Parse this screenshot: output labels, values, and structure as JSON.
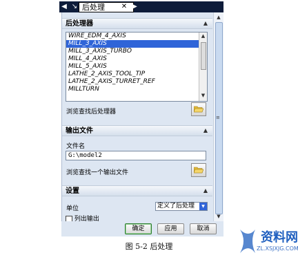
{
  "tab": {
    "left_arrow": "◀",
    "pin": "↘",
    "title": "后处理",
    "close": "✕",
    "right_arrow": "▶"
  },
  "postprocessors_section": {
    "header": "后处理器",
    "items": [
      "WIRE_EDM_4_AXIS",
      "MILL_3_AXIS",
      "MILL_3_AXIS_TURBO",
      "MILL_4_AXIS",
      "MILL_5_AXIS",
      "LATHE_2_AXIS_TOOL_TIP",
      "LATHE_2_AXIS_TURRET_REF",
      "MILLTURN"
    ],
    "selected_index": 1,
    "browse_label": "浏览查找后处理器"
  },
  "output_section": {
    "header": "输出文件",
    "file_name_label": "文件名",
    "file_name_value": "G:\\model2",
    "browse_label": "浏览查找一个输出文件"
  },
  "settings_section": {
    "header": "设置",
    "unit_label": "单位",
    "unit_value": "定义了后处理",
    "checkbox_label": "列出输出"
  },
  "buttons": {
    "ok": "确定",
    "apply": "应用",
    "cancel": "取消"
  },
  "caption": "图 5-2  后处理",
  "watermark": {
    "text": "资料网",
    "url": "ZL.XSJXJG.COM"
  },
  "icons": {
    "folder": "open-folder-icon",
    "collapse": "chevron-up-icon"
  },
  "colors": {
    "selection": "#2f64d8",
    "panel_bg": "#dde6f2",
    "tab_bar": "#0e1c3a"
  }
}
